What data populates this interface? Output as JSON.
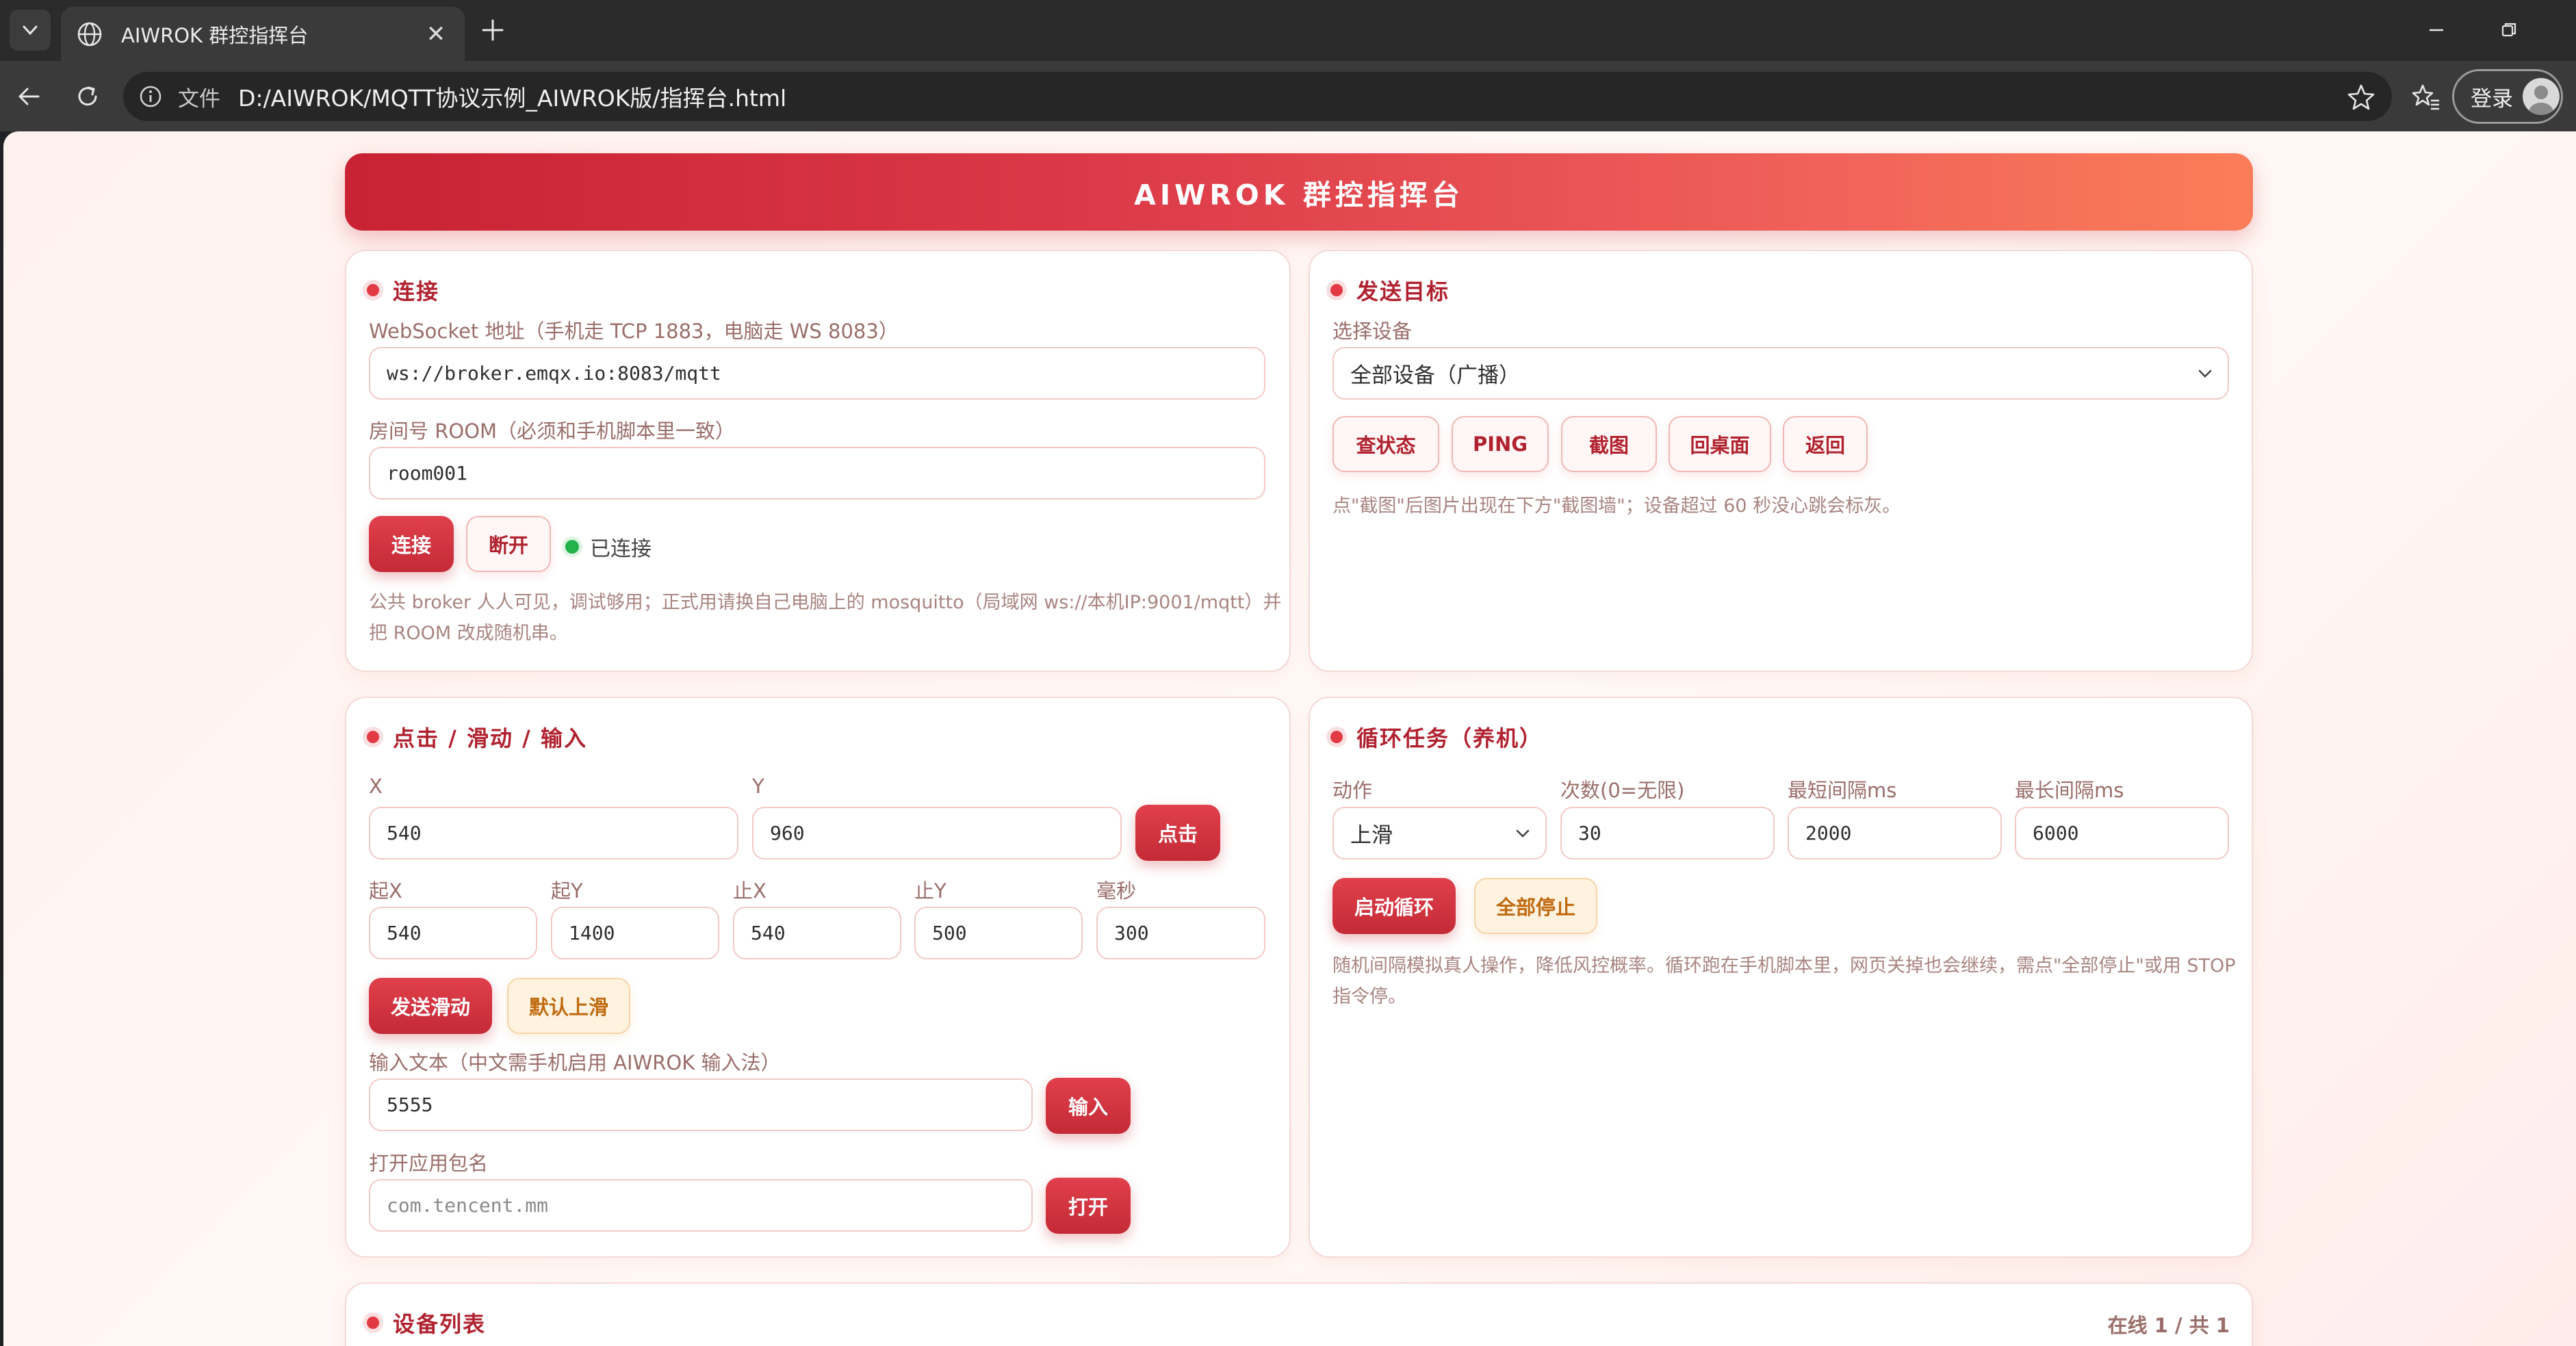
{
  "browser": {
    "tab_title": "AIWROK 群控指挥台",
    "scheme_label": "文件",
    "url": "D:/AIWROK/MQTT协议示例_AIWROK版/指挥台.html",
    "login_label": "登录"
  },
  "page": {
    "title": "AIWROK 群控指挥台"
  },
  "connect": {
    "title": "连接",
    "ws_label": "WebSocket 地址（手机走 TCP 1883，电脑走 WS 8083）",
    "ws_value": "ws://broker.emqx.io:8083/mqtt",
    "room_label": "房间号 ROOM（必须和手机脚本里一致）",
    "room_value": "room001",
    "connect_label": "连接",
    "disconnect_label": "断开",
    "status_text": "已连接",
    "status_color": "#22b24c",
    "hint_line1": "公共 broker 人人可见，调试够用；正式用请换自己电脑上的 mosquitto（局域网 ws://本机IP:9001/mqtt）并",
    "hint_line2": "把 ROOM 改成随机串。"
  },
  "target": {
    "title": "发送目标",
    "device_label": "选择设备",
    "device_selected": "全部设备（广播）",
    "buttons": [
      "查状态",
      "PING",
      "截图",
      "回桌面",
      "返回"
    ],
    "hint": "点\"截图\"后图片出现在下方\"截图墙\"；设备超过 60 秒没心跳会标灰。"
  },
  "input": {
    "title": "点击 / 滑动 / 输入",
    "x_label": "X",
    "x_value": "540",
    "y_label": "Y",
    "y_value": "960",
    "tap_label": "点击",
    "sx_label": "起X",
    "sx_value": "540",
    "sy_label": "起Y",
    "sy_value": "1400",
    "ex_label": "止X",
    "ex_value": "540",
    "ey_label": "止Y",
    "ey_value": "500",
    "ms_label": "毫秒",
    "ms_value": "300",
    "swipe_label": "发送滑动",
    "default_up_label": "默认上滑",
    "text_label": "输入文本（中文需手机启用 AIWROK 输入法）",
    "text_value": "5555",
    "input_btn_label": "输入",
    "pkg_label": "打开应用包名",
    "pkg_placeholder": "com.tencent.mm",
    "open_label": "打开"
  },
  "loop": {
    "title": "循环任务（养机）",
    "action_label": "动作",
    "action_selected": "上滑",
    "count_label": "次数(0=无限)",
    "count_value": "30",
    "min_label": "最短间隔ms",
    "min_value": "2000",
    "max_label": "最长间隔ms",
    "max_value": "6000",
    "start_label": "启动循环",
    "stop_label": "全部停止",
    "hint_line1": "随机间隔模拟真人操作，降低风控概率。循环跑在手机脚本里，网页关掉也会继续，需点\"全部停止\"或用 STOP",
    "hint_line2": "指令停。"
  },
  "devices": {
    "title": "设备列表",
    "count_text": "在线 1 / 共 1"
  },
  "colors": {
    "accent": "#c42a36",
    "banner_start": "#c82233",
    "banner_end": "#fb7d58",
    "amber": "#c06a10"
  }
}
